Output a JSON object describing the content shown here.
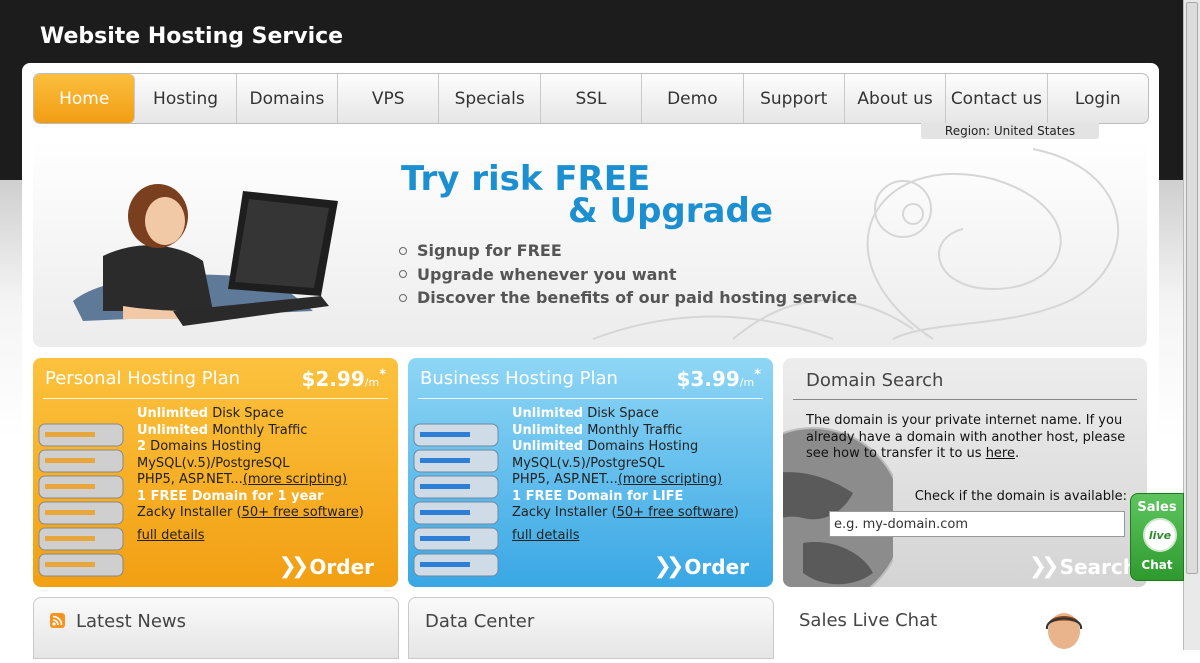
{
  "site": {
    "title": "Website Hosting Service"
  },
  "nav": {
    "items": [
      {
        "label": "Home",
        "active": true
      },
      {
        "label": "Hosting"
      },
      {
        "label": "Domains"
      },
      {
        "label": "VPS"
      },
      {
        "label": "Specials"
      },
      {
        "label": "SSL"
      },
      {
        "label": "Demo"
      },
      {
        "label": "Support"
      },
      {
        "label": "About us"
      },
      {
        "label": "Contact us"
      },
      {
        "label": "Login"
      }
    ],
    "region": "Region: United States"
  },
  "banner": {
    "headline_line1": "Try risk FREE",
    "headline_line2": "& Upgrade",
    "bullets": [
      "Signup for FREE",
      "Upgrade whenever you want",
      "Discover the benefits of our paid hosting service"
    ]
  },
  "plans": [
    {
      "title": "Personal Hosting Plan",
      "price": "$2.99",
      "price_unit": "/m",
      "price_mark": "*",
      "f1_hl": "Unlimited",
      "f1_txt": " Disk Space",
      "f2_hl": "Unlimited",
      "f2_txt": " Monthly Traffic",
      "f3_hl": "2",
      "f3_txt": " Domains Hosting",
      "f4": "MySQL(v.5)/PostgreSQL",
      "f5_txt": "PHP5, ASP.NET...",
      "f5_link": "(more scripting)",
      "f6": "1 FREE Domain for 1 year",
      "f7_txt": "Zacky Installer (",
      "f7_link": "50+ free software",
      "f7_end": ")",
      "details": "full details",
      "order": "Order"
    },
    {
      "title": "Business Hosting Plan",
      "price": "$3.99",
      "price_unit": "/m",
      "price_mark": "*",
      "f1_hl": "Unlimited",
      "f1_txt": " Disk Space",
      "f2_hl": "Unlimited",
      "f2_txt": " Monthly Traffic",
      "f3_hl": "Unlimited",
      "f3_txt": " Domains Hosting",
      "f4": "MySQL(v.5)/PostgreSQL",
      "f5_txt": "PHP5, ASP.NET...",
      "f5_link": "(more scripting)",
      "f6": "1 FREE Domain for LIFE",
      "f7_txt": "Zacky Installer (",
      "f7_link": "50+ free software",
      "f7_end": ")",
      "details": "full details",
      "order": "Order"
    }
  ],
  "domain_search": {
    "title": "Domain Search",
    "text": "The domain is your private internet name. If you already have a domain with another host, please see how to transfer it to us ",
    "link": "here",
    "text_end": ".",
    "check_label": "Check if the domain is available:",
    "placeholder": "e.g. my-domain.com",
    "button": "Search"
  },
  "sales_tab": {
    "top": "Sales",
    "bubble": "live",
    "bottom": "Chat"
  },
  "bottom": {
    "news_title": "Latest News",
    "dc_title": "Data Center",
    "chat_title": "Sales Live Chat"
  },
  "colors": {
    "brand_blue": "#1b8fd0",
    "nav_active": "#f29d12",
    "personal_plan": "#f29f13",
    "business_plan": "#39a7e4",
    "live_chat": "#2e9a2e"
  }
}
